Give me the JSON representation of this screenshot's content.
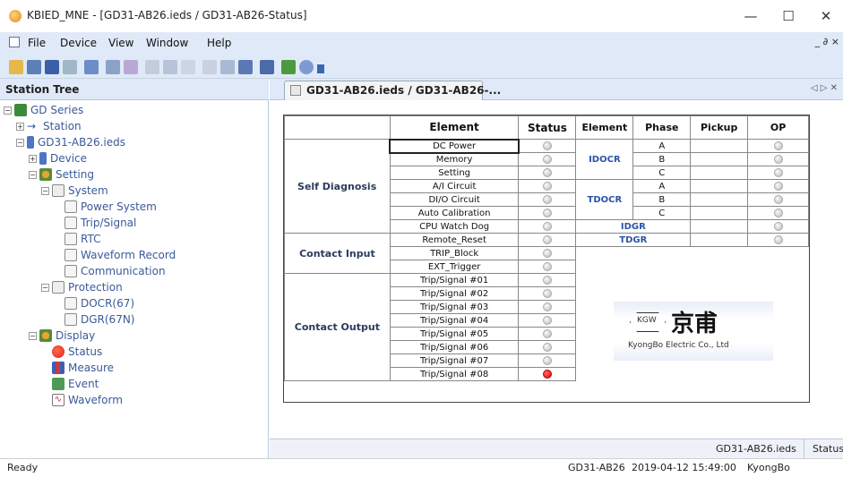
{
  "window": {
    "title": "KBIED_MNE - [GD31-AB26.ieds / GD31-AB26-Status]",
    "minimize": "—",
    "maximize": "☐",
    "close": "✕"
  },
  "menu": {
    "items": [
      "File",
      "Device",
      "View",
      "Window",
      "Help"
    ],
    "mdi_controls": "_ ∂ ×"
  },
  "station_tree": {
    "header": "Station Tree",
    "nodes": [
      {
        "label": "GD Series",
        "icon": "series-icon"
      },
      {
        "label": "Station",
        "icon": "arrow-icon"
      },
      {
        "label": "GD31-AB26.ieds",
        "icon": "ied-file-icon"
      },
      {
        "label": "Device",
        "icon": "device-icon"
      },
      {
        "label": "Setting",
        "icon": "setting-icon"
      },
      {
        "label": "System",
        "icon": "wrench-folder-icon"
      },
      {
        "label": "Power System",
        "icon": "wrench-icon"
      },
      {
        "label": "Trip/Signal",
        "icon": "wrench-icon"
      },
      {
        "label": "RTC",
        "icon": "wrench-icon"
      },
      {
        "label": "Waveform Record",
        "icon": "wrench-icon"
      },
      {
        "label": "Communication",
        "icon": "wrench-icon"
      },
      {
        "label": "Protection",
        "icon": "wrench-folder-icon"
      },
      {
        "label": "DOCR(67)",
        "icon": "wrench-icon"
      },
      {
        "label": "DGR(67N)",
        "icon": "wrench-icon"
      },
      {
        "label": "Display",
        "icon": "display-icon"
      },
      {
        "label": "Status",
        "icon": "status-red-icon"
      },
      {
        "label": "Measure",
        "icon": "measure-icon"
      },
      {
        "label": "Event",
        "icon": "event-icon"
      },
      {
        "label": "Waveform",
        "icon": "waveform-icon"
      }
    ]
  },
  "tabs": {
    "active": "GD31-AB26.ieds / GD31-AB26-...",
    "nav": "◁ ▷ ✕"
  },
  "status_table": {
    "headers": {
      "element": "Element",
      "status": "Status",
      "element2": "Element",
      "phase": "Phase",
      "pickup": "Pickup",
      "op": "OP"
    },
    "groups": {
      "self_diagnosis": "Self Diagnosis",
      "contact_input": "Contact Input",
      "contact_output": "Contact Output"
    },
    "rows": [
      {
        "element": "DC Power",
        "on": false
      },
      {
        "element": "Memory",
        "on": false
      },
      {
        "element": "Setting",
        "on": false
      },
      {
        "element": "A/I Circuit",
        "on": false
      },
      {
        "element": "DI/O Circuit",
        "on": false
      },
      {
        "element": "Auto Calibration",
        "on": false
      },
      {
        "element": "CPU Watch Dog",
        "on": false
      },
      {
        "element": "Remote_Reset",
        "on": false
      },
      {
        "element": "TRIP_Block",
        "on": false
      },
      {
        "element": "EXT_Trigger",
        "on": false
      },
      {
        "element": "Trip/Signal #01",
        "on": false
      },
      {
        "element": "Trip/Signal #02",
        "on": false
      },
      {
        "element": "Trip/Signal #03",
        "on": false
      },
      {
        "element": "Trip/Signal #04",
        "on": false
      },
      {
        "element": "Trip/Signal #05",
        "on": false
      },
      {
        "element": "Trip/Signal #06",
        "on": false
      },
      {
        "element": "Trip/Signal #07",
        "on": false
      },
      {
        "element": "Trip/Signal #08",
        "on": true
      }
    ],
    "protection": {
      "idocr": "IDOCR",
      "tdocr": "TDOCR",
      "idgr": "IDGR",
      "tdgr": "TDGR",
      "phases": [
        "A",
        "B",
        "C"
      ]
    }
  },
  "logo": {
    "symbol": "KGW",
    "chinese": "京甫",
    "company": "KyongBo Electric Co., Ltd"
  },
  "doc_status": {
    "device": "GD31-AB26.ieds",
    "label": "Status"
  },
  "statusbar": {
    "ready": "Ready",
    "device": "GD31-AB26",
    "datetime": "2019-04-12 15:49:00",
    "company": "KyongBo"
  }
}
